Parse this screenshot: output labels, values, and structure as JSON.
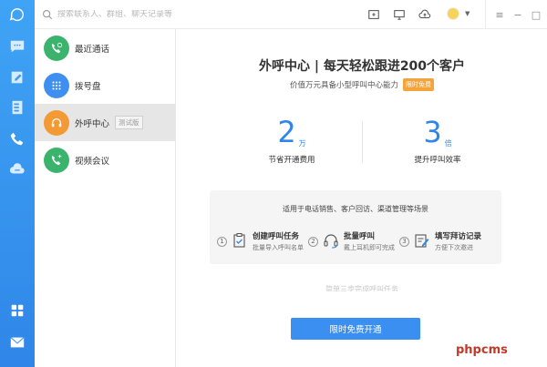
{
  "search": {
    "placeholder": "搜索联系人、群组、聊天记录等"
  },
  "contacts": [
    {
      "label": "最近通话",
      "color": "#3bb36d",
      "icon": "phone-recent-icon"
    },
    {
      "label": "拨号盘",
      "color": "#3f8ff0",
      "icon": "dialpad-icon"
    },
    {
      "label": "外呼中心",
      "color": "#f39a35",
      "icon": "headset-icon",
      "tag": "测试版"
    },
    {
      "label": "视频会议",
      "color": "#3bb36d",
      "icon": "video-call-icon"
    }
  ],
  "main": {
    "headline": "外呼中心 | 每天轻松跟进200个客户",
    "subline": "价值万元具备小型呼叫中心能力",
    "promo": "限时免费",
    "stats": [
      {
        "value": "2",
        "unit": "万",
        "label": "节省开通费用"
      },
      {
        "value": "3",
        "unit": "倍",
        "label": "提升呼叫效率"
      }
    ],
    "panel_title": "适用于电话销售、客户回访、渠道管理等场景",
    "steps": [
      {
        "num": "1",
        "title": "创建呼叫任务",
        "desc": "批量导入呼叫名单",
        "icon": "clipboard-icon"
      },
      {
        "num": "2",
        "title": "批量呼叫",
        "desc": "戴上耳机即可完成",
        "icon": "headset-icon"
      },
      {
        "num": "3",
        "title": "填写拜访记录",
        "desc": "方便下次邀进",
        "icon": "edit-note-icon"
      }
    ],
    "faint_text": "简单三步完成呼叫任务",
    "cta": "限时免费开通"
  },
  "colors": {
    "accent": "#2f86e8",
    "rail": "#3fa4f5",
    "promo": "#f5a43c"
  },
  "watermark": "phpcms"
}
